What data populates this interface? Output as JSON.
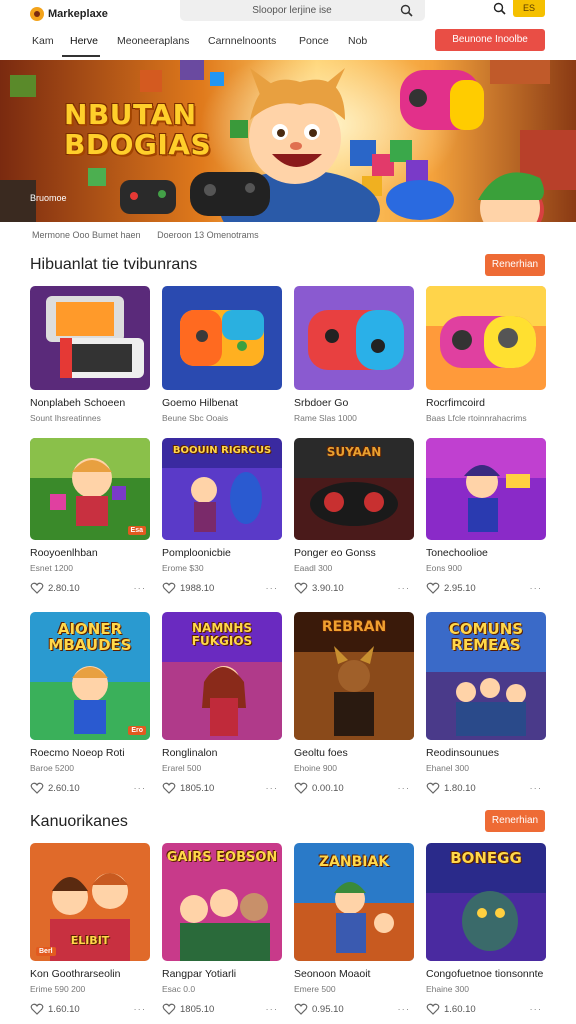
{
  "header": {
    "logo_text": "Markeplaxe",
    "search_placeholder": "Sloopor lerjine ise",
    "badge": "ES"
  },
  "nav": {
    "items": [
      "Kam",
      "Herve",
      "Meoneeraplans",
      "Carnnelnoonts",
      "Ponce",
      "Nob"
    ],
    "active_index": 1,
    "cta": "Beunone   Inoolbe"
  },
  "hero": {
    "title_line1": "NBUTAN",
    "title_line2": "BDOGIAS",
    "caption": "Bruomoe"
  },
  "breadcrumb": [
    "Mermone  Ooo  Bumet haen",
    "Doeroon 13  Omenotrams"
  ],
  "sections": [
    {
      "title": "Hibuanlat tie tvibunrans",
      "button": "Renerhian",
      "cards": [
        {
          "title": "Nonplabeh Schoeen",
          "sub": "Sount Ihsreatinnes",
          "likes": "",
          "tag": ""
        },
        {
          "title": "Goemo  Hilbenat",
          "sub": "Beune Sbc  Ooais",
          "likes": "",
          "tag": ""
        },
        {
          "title": "Srbdoer  Go",
          "sub": "Rame  Slas  1000",
          "likes": "",
          "tag": ""
        },
        {
          "title": "Rocrfimcoird",
          "sub": "Baas Lfcle rtoinnrahacrims",
          "likes": "",
          "tag": ""
        },
        {
          "title": "Rooyoenlhban",
          "sub": "Esnet 1200",
          "likes": "2.80.10",
          "tag": "Esa"
        },
        {
          "title": "Pomploonicbie",
          "sub": "Erome $30",
          "likes": "1988.10",
          "tag": "",
          "thumb_text": "BOOUIN RIGRCUS"
        },
        {
          "title": "Ponger eo Gonss",
          "sub": "Eaadl 300",
          "likes": "3.90.10",
          "tag": "",
          "thumb_text": "SUYAAN"
        },
        {
          "title": "Tonechoolioe",
          "sub": "Eons 900",
          "likes": "2.95.10",
          "tag": ""
        },
        {
          "title": "Roecmo  Noeop  Roti",
          "sub": "Baroe 5200",
          "likes": "2.60.10",
          "tag": "Ero",
          "thumb_text": "AIONER MBAUDES"
        },
        {
          "title": "Ronglinalon",
          "sub": "Erarel 500",
          "likes": "1805.10",
          "tag": "",
          "thumb_text": "NAMNHS FUKGIOS"
        },
        {
          "title": "Geoltu  foes",
          "sub": "Ehoine 900",
          "likes": "0.00.10",
          "tag": "",
          "thumb_text": "REBRAN"
        },
        {
          "title": "Reodinsounues",
          "sub": "Ehanel 300",
          "likes": "1.80.10",
          "tag": "",
          "thumb_text": "COMUNS REMEAS"
        }
      ]
    },
    {
      "title": "Kanuorikanes",
      "button": "Renerhian",
      "cards": [
        {
          "title": "Kon Goothrarseolin",
          "sub": "Erime 590 200",
          "likes": "1.60.10",
          "tag": "Berl",
          "thumb_text": "ELIBIT"
        },
        {
          "title": "Rangpar  Yotiarli",
          "sub": "Esac  0.0",
          "likes": "1805.10",
          "tag": "",
          "thumb_text": "GAIRS EOBSON"
        },
        {
          "title": "Seonoon  Moaoit",
          "sub": "Emere 500",
          "likes": "0.95.10",
          "tag": "",
          "thumb_text": "ZANBIAK"
        },
        {
          "title": "Congofuetnoe tionsonnte",
          "sub": "Ehaine 300",
          "likes": "1.60.10",
          "tag": "",
          "thumb_text": "BONEGG"
        }
      ]
    }
  ],
  "colors": {
    "accent": "#ee6b35",
    "cta_red": "#e94e45",
    "badge_yellow": "#f5c000",
    "hero_title": "#ffcf2b"
  }
}
